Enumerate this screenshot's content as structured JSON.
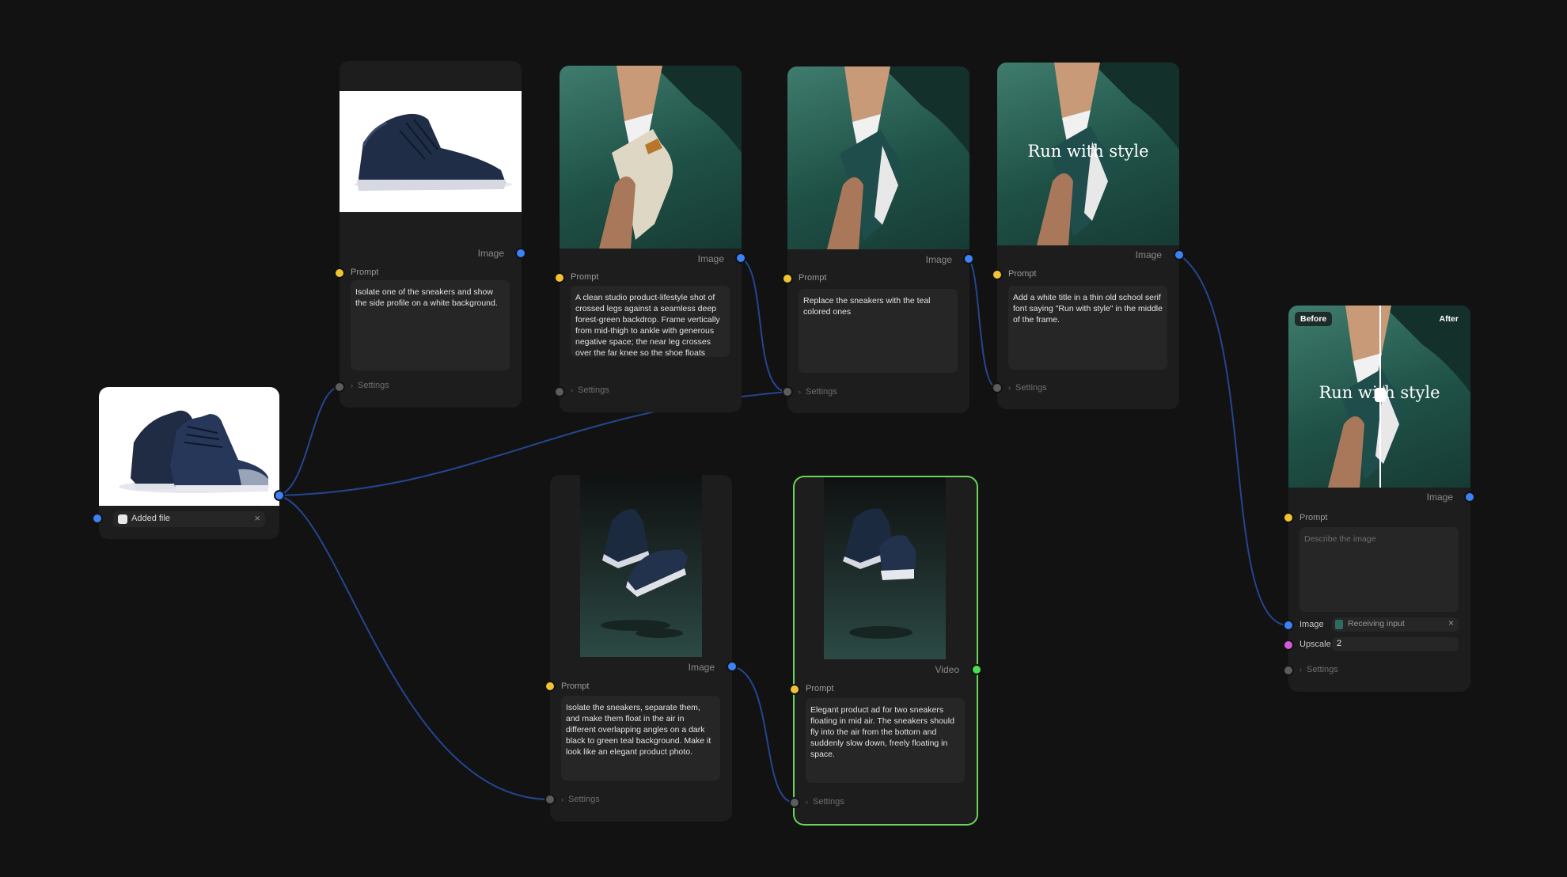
{
  "canvas": {
    "labels": {
      "image": "Image",
      "video": "Video",
      "prompt": "Prompt",
      "settings": "Settings",
      "upscale": "Upscale"
    },
    "source_node": {
      "file_label": "Added file",
      "close_icon": "×"
    },
    "nodes": {
      "isolate_side": {
        "prompt": "Isolate one of the sneakers and show the side profile on a white background."
      },
      "studio_lifestyle": {
        "prompt": "A clean studio product-lifestyle shot of crossed legs against a seamless deep forest-green backdrop. Frame vertically from mid-thigh to ankle with generous negative space; the near leg crosses over the far knee so the shoe floats diagonally toe pointing left, heel"
      },
      "replace_sneakers": {
        "prompt": "Replace the sneakers with the teal colored ones"
      },
      "add_title": {
        "prompt": "Add a white title in a thin old school serif font saying \"Run with style\" in the middle of the frame.",
        "overlay_title": "Run with style"
      },
      "float_sneakers": {
        "prompt": "Isolate the sneakers, separate them, and make them float in the air in different overlapping angles on a dark black to green teal background. Make it look like an elegant product photo."
      },
      "video_ad": {
        "prompt": "Elegant product ad for two sneakers floating in mid air. The sneakers should fly into the air from the bottom and suddenly slow down, freely floating in space."
      },
      "upscale": {
        "before_label": "Before",
        "after_label": "After",
        "overlay_title": "Run with style",
        "prompt_placeholder": "Describe the image",
        "image_status": "Receiving input",
        "upscale_value": "2"
      }
    },
    "colors": {
      "background": "#121212",
      "node": "#1d1d1d",
      "edge": "#2a4a96",
      "port_image": "#3b82f6",
      "port_prompt": "#f1c232",
      "port_video": "#4ade50",
      "port_upscale": "#d35ad9",
      "selected": "#6bd45a"
    }
  }
}
